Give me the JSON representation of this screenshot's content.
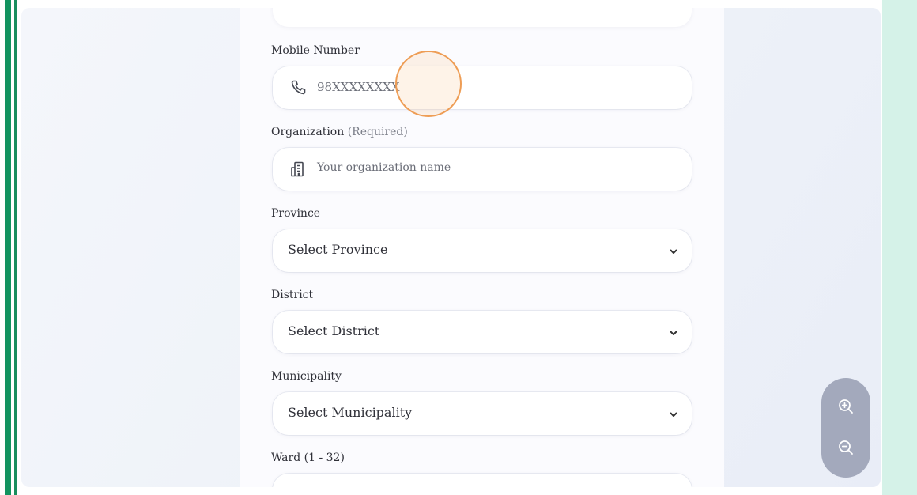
{
  "form": {
    "mobile": {
      "label": "Mobile Number",
      "placeholder": "98XXXXXXXX",
      "icon": "phone-icon"
    },
    "organization": {
      "label": "Organization",
      "hint": "(Required)",
      "placeholder": "Your organization name",
      "icon": "building-icon"
    },
    "province": {
      "label": "Province",
      "selected": "Select Province"
    },
    "district": {
      "label": "District",
      "selected": "Select District"
    },
    "municipality": {
      "label": "Municipality",
      "selected": "Select Municipality"
    },
    "ward": {
      "label": "Ward (1 - 32)",
      "value": ""
    }
  },
  "zoom": {
    "in_icon": "zoom-in-icon",
    "out_icon": "zoom-out-icon"
  },
  "colors": {
    "accent_green": "#12935f",
    "right_panel": "#d5f2e8",
    "cursor_ring": "#ee9d55",
    "zoom_pill": "#a3a9bc"
  }
}
